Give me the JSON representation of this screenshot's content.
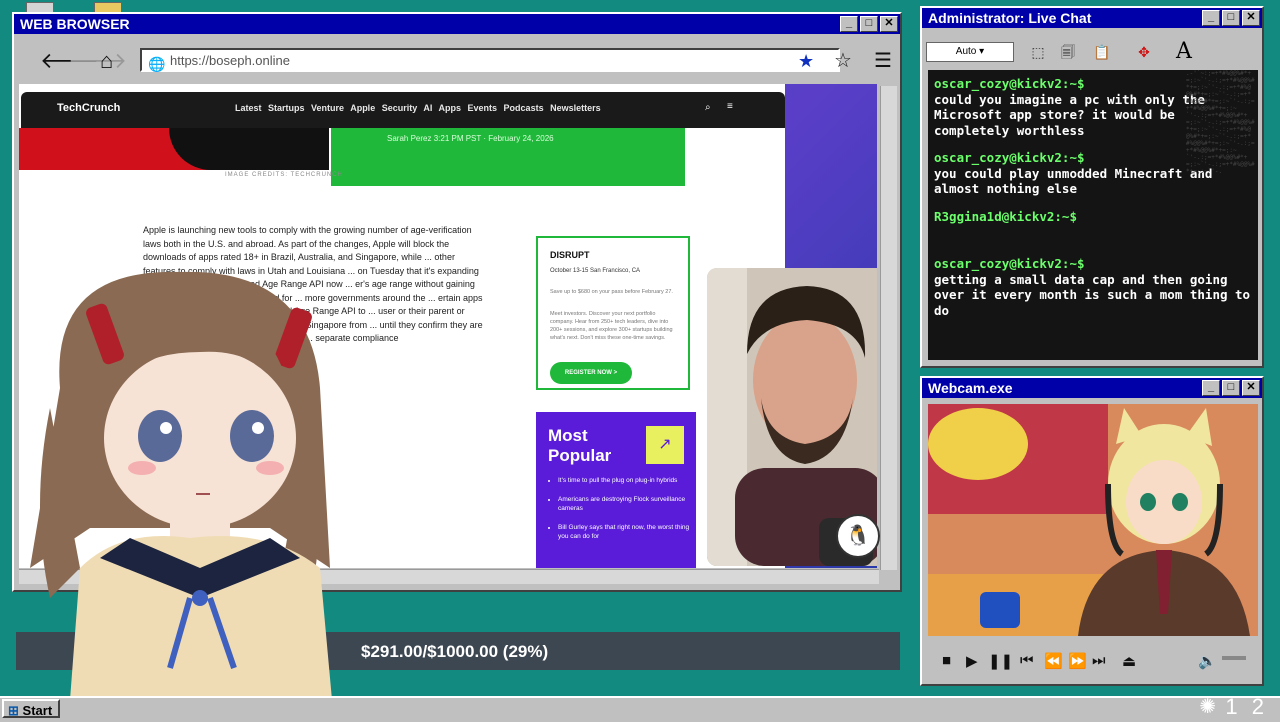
{
  "browser": {
    "title": "WEB BROWSER",
    "url": "https://boseph.online",
    "site": {
      "logo": "TechCrunch",
      "nav_links": "Latest  Startups  Venture  Apple  Security  AI  Apps  Events  Podcasts  Newsletters",
      "byline": "Sarah Perez    3:21 PM PST · February 24, 2026",
      "credits": "IMAGE CREDITS: TECHCRUNCH",
      "article_text": "Apple is launching new tools to comply with the growing number of age-verification laws both in the U.S. and abroad. As part of the changes, Apple will block the downloads of apps rated 18+ in Brazil, Australia, and Singapore, while ... other features to comply with laws in Utah and Louisiana ... on Tuesday that it's expanding its set of ... updated Declared Age Range API now ... er's age range without gaining ... like their date of birth. The need for ... more governments around the ... ertain apps like social media that ... use Declared Age Range API to ... user or their parent or guardian chooses ... ustralia, Brazil, and Singapore from ... until they confirm they are adults. ... the confirmation automatically, ... separate compliance",
      "promo": {
        "logo": "DISRUPT",
        "dates": "October 13-15   San Francisco, CA",
        "offer": "Save up to $680 on your pass before February 27.",
        "blurb": "Meet investors. Discover your next portfolio company. Hear from 250+ tech leaders, dive into 200+ sessions, and explore 300+ startups building what's next. Don't miss these one-time savings.",
        "button": "REGISTER NOW  >"
      },
      "popular": {
        "heading": "Most Popular",
        "items": [
          "It's time to pull the plug on plug-in hybrids",
          "Americans are destroying Flock surveillance cameras",
          "Bill Gurley says that right now, the worst thing you can do for"
        ]
      }
    }
  },
  "goal": {
    "text": "$291.00/$1000.00 (29%)",
    "fraction": 0.29
  },
  "chat": {
    "title": "Administrator: Live Chat",
    "select_value": "Auto",
    "messages": [
      {
        "user": "oscar_cozy@kickv2:~$",
        "text": "could you imagine a pc with only the Microsoft app store? it would be completely worthless"
      },
      {
        "user": "oscar_cozy@kickv2:~$",
        "text": "you could play unmodded Minecraft and almost nothing else"
      },
      {
        "user": "R3ggina1d@kickv2:~$",
        "text": ""
      },
      {
        "user": "oscar_cozy@kickv2:~$",
        "text": "getting a small data cap and then going over it every month is such a mom thing to do"
      }
    ]
  },
  "webcam": {
    "title": "Webcam.exe"
  },
  "taskbar": {
    "start_label": "Start",
    "clock": "1 2"
  }
}
